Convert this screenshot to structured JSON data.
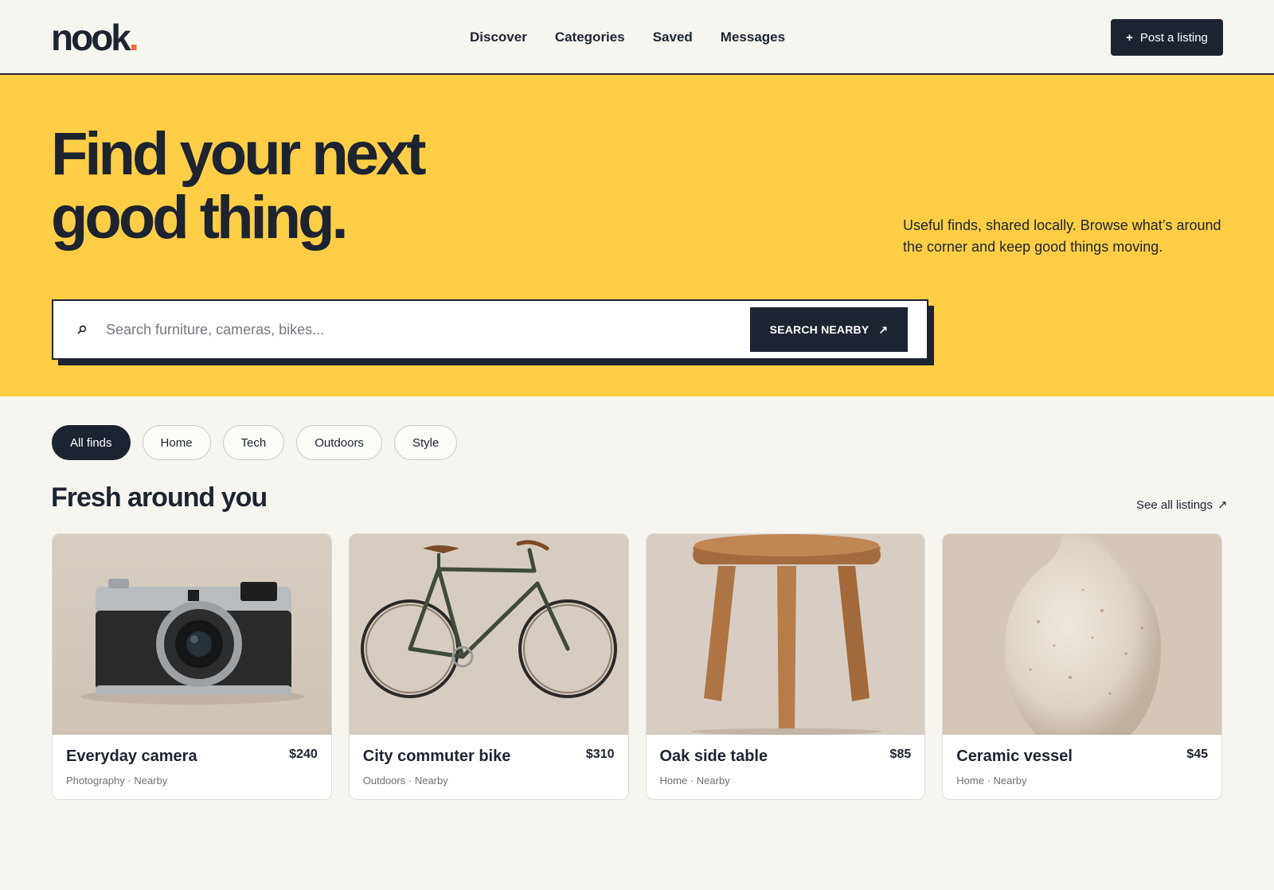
{
  "brand": {
    "name": "nook",
    "dot": ".",
    "accent": "#ee6a3c"
  },
  "nav": {
    "items": [
      {
        "label": "Discover"
      },
      {
        "label": "Categories"
      },
      {
        "label": "Saved"
      },
      {
        "label": "Messages"
      }
    ]
  },
  "actions": {
    "post_icon": "+",
    "post_label": "Post a listing"
  },
  "hero": {
    "title_line1": "Find your next",
    "title_line2": "good thing.",
    "subtitle": "Useful finds, shared locally. Browse what’s around the corner and keep good things moving.",
    "background": "#ffce44"
  },
  "search": {
    "icon": "search-icon",
    "placeholder": "Search furniture, cameras, bikes...",
    "value": "",
    "button_label": "SEARCH NEARBY",
    "button_icon": "↗"
  },
  "filters": {
    "items": [
      {
        "label": "All finds",
        "active": true
      },
      {
        "label": "Home",
        "active": false
      },
      {
        "label": "Tech",
        "active": false
      },
      {
        "label": "Outdoors",
        "active": false
      },
      {
        "label": "Style",
        "active": false
      }
    ]
  },
  "section": {
    "title": "Fresh around you",
    "see_all_label": "See all listings",
    "see_all_icon": "↗"
  },
  "listings": [
    {
      "title": "Everyday camera",
      "price": "$240",
      "category": "Photography",
      "separator": "·",
      "distance": "Nearby",
      "image": "camera-photo"
    },
    {
      "title": "City commuter bike",
      "price": "$310",
      "category": "Outdoors",
      "separator": "·",
      "distance": "Nearby",
      "image": "bike-photo"
    },
    {
      "title": "Oak side table",
      "price": "$85",
      "category": "Home",
      "separator": "·",
      "distance": "Nearby",
      "image": "table-photo"
    },
    {
      "title": "Ceramic vessel",
      "price": "$45",
      "category": "Home",
      "separator": "·",
      "distance": "Nearby",
      "image": "vase-photo"
    }
  ],
  "colors": {
    "ink": "#1d2431",
    "paper": "#f6f5f0",
    "hero": "#ffce44"
  }
}
